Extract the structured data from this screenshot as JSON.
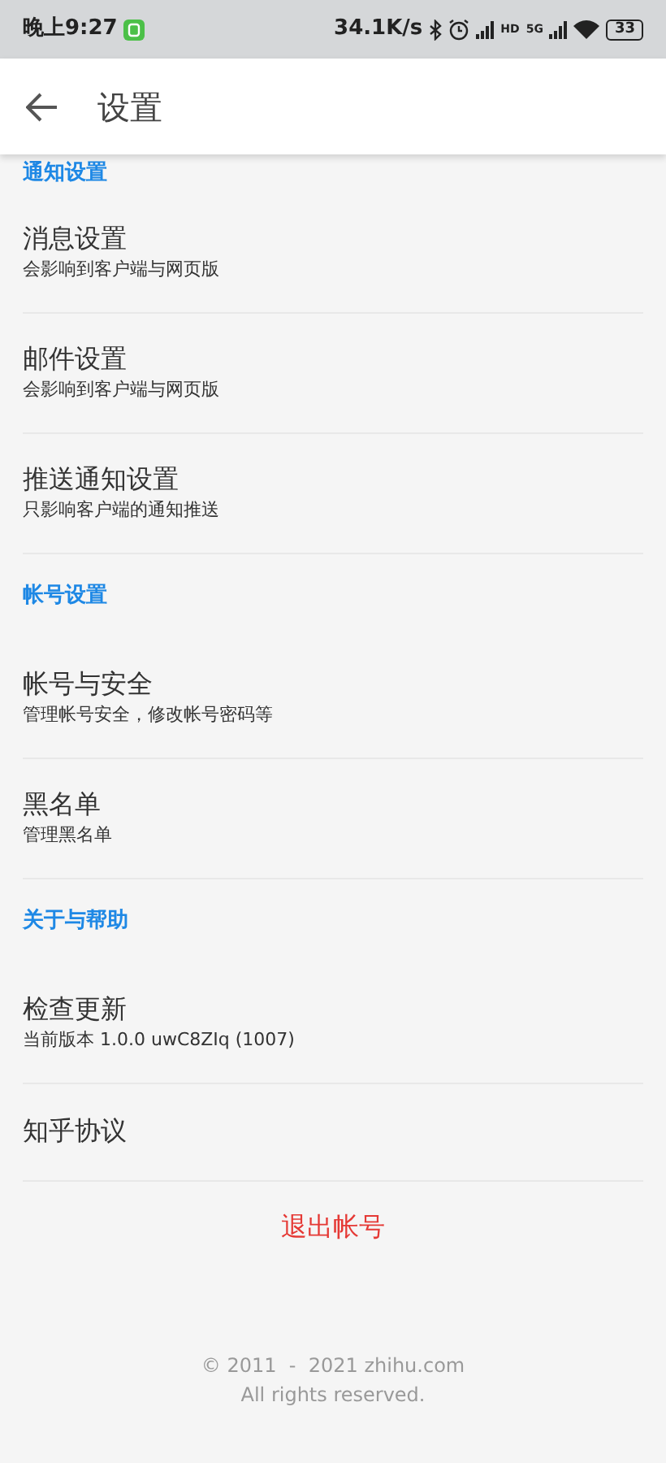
{
  "status_bar": {
    "time": "晚上9:27",
    "speed": "34.1K/s",
    "hd": "HD",
    "network": "5G",
    "battery": "33"
  },
  "app_bar": {
    "title": "设置"
  },
  "sections": [
    {
      "header": "通知设置",
      "items": [
        {
          "title": "消息设置",
          "subtitle": "会影响到客户端与网页版"
        },
        {
          "title": "邮件设置",
          "subtitle": "会影响到客户端与网页版"
        },
        {
          "title": "推送通知设置",
          "subtitle": "只影响客户端的通知推送"
        }
      ]
    },
    {
      "header": "帐号设置",
      "items": [
        {
          "title": "帐号与安全",
          "subtitle": "管理帐号安全，修改帐号密码等"
        },
        {
          "title": "黑名单",
          "subtitle": "管理黑名单"
        }
      ]
    },
    {
      "header": "关于与帮助",
      "items": [
        {
          "title": "检查更新",
          "subtitle": "当前版本 1.0.0 uwC8ZIq (1007)"
        },
        {
          "title": "知乎协议"
        }
      ]
    }
  ],
  "logout": "退出帐号",
  "footer": {
    "copyright": "© 2011  -  2021 zhihu.com",
    "rights": "All rights reserved."
  }
}
